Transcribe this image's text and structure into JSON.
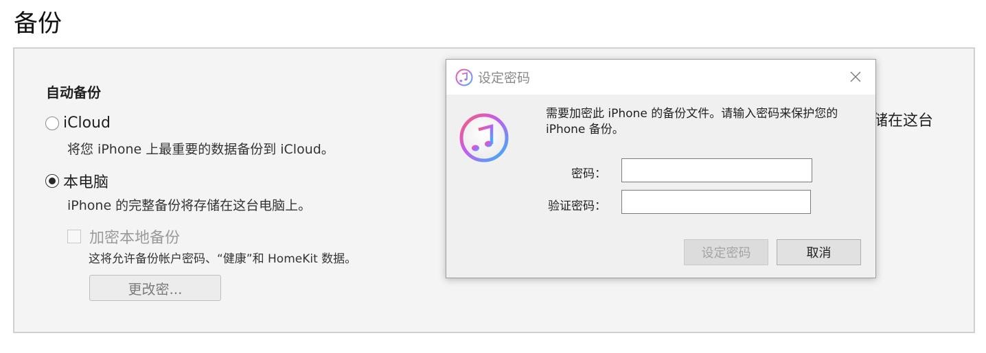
{
  "page": {
    "title": "备份"
  },
  "auto_backup": {
    "heading": "自动备份",
    "options": [
      {
        "label": "iCloud",
        "description": "将您 iPhone 上最重要的数据备份到 iCloud。",
        "selected": false
      },
      {
        "label": "本电脑",
        "description": "iPhone 的完整备份将存储在这台电脑上。",
        "selected": true
      }
    ],
    "encrypt": {
      "label": "加密本地备份",
      "checked": false,
      "enabled": false
    },
    "encrypt_note": "这将允许备份帐户密码、“健康”和 HomeKit 数据。",
    "change_password_label": "更改密...",
    "truncated_right_text": "储在这台"
  },
  "dialog": {
    "title": "设定密码",
    "message": "需要加密此 iPhone 的备份文件。请输入密码来保护您的 iPhone 备份。",
    "password_label": "密码：",
    "password_value": "",
    "verify_label": "验证密码：",
    "verify_value": "",
    "set_button_label": "设定密码",
    "cancel_button_label": "取消",
    "icon": "itunes-music-icon",
    "close_icon": "close-icon"
  }
}
